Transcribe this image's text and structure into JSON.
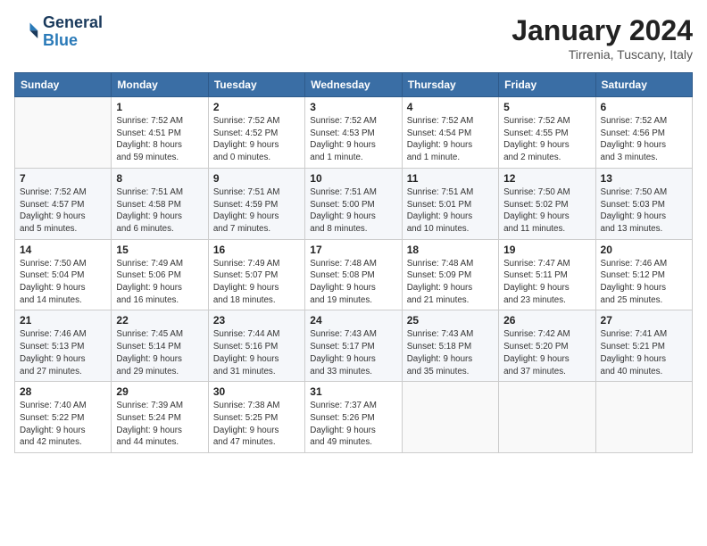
{
  "header": {
    "logo_line1": "General",
    "logo_line2": "Blue",
    "month": "January 2024",
    "location": "Tirrenia, Tuscany, Italy"
  },
  "days_of_week": [
    "Sunday",
    "Monday",
    "Tuesday",
    "Wednesday",
    "Thursday",
    "Friday",
    "Saturday"
  ],
  "weeks": [
    [
      {
        "day": "",
        "info": ""
      },
      {
        "day": "1",
        "info": "Sunrise: 7:52 AM\nSunset: 4:51 PM\nDaylight: 8 hours\nand 59 minutes."
      },
      {
        "day": "2",
        "info": "Sunrise: 7:52 AM\nSunset: 4:52 PM\nDaylight: 9 hours\nand 0 minutes."
      },
      {
        "day": "3",
        "info": "Sunrise: 7:52 AM\nSunset: 4:53 PM\nDaylight: 9 hours\nand 1 minute."
      },
      {
        "day": "4",
        "info": "Sunrise: 7:52 AM\nSunset: 4:54 PM\nDaylight: 9 hours\nand 1 minute."
      },
      {
        "day": "5",
        "info": "Sunrise: 7:52 AM\nSunset: 4:55 PM\nDaylight: 9 hours\nand 2 minutes."
      },
      {
        "day": "6",
        "info": "Sunrise: 7:52 AM\nSunset: 4:56 PM\nDaylight: 9 hours\nand 3 minutes."
      }
    ],
    [
      {
        "day": "7",
        "info": "Sunrise: 7:52 AM\nSunset: 4:57 PM\nDaylight: 9 hours\nand 5 minutes."
      },
      {
        "day": "8",
        "info": "Sunrise: 7:51 AM\nSunset: 4:58 PM\nDaylight: 9 hours\nand 6 minutes."
      },
      {
        "day": "9",
        "info": "Sunrise: 7:51 AM\nSunset: 4:59 PM\nDaylight: 9 hours\nand 7 minutes."
      },
      {
        "day": "10",
        "info": "Sunrise: 7:51 AM\nSunset: 5:00 PM\nDaylight: 9 hours\nand 8 minutes."
      },
      {
        "day": "11",
        "info": "Sunrise: 7:51 AM\nSunset: 5:01 PM\nDaylight: 9 hours\nand 10 minutes."
      },
      {
        "day": "12",
        "info": "Sunrise: 7:50 AM\nSunset: 5:02 PM\nDaylight: 9 hours\nand 11 minutes."
      },
      {
        "day": "13",
        "info": "Sunrise: 7:50 AM\nSunset: 5:03 PM\nDaylight: 9 hours\nand 13 minutes."
      }
    ],
    [
      {
        "day": "14",
        "info": "Sunrise: 7:50 AM\nSunset: 5:04 PM\nDaylight: 9 hours\nand 14 minutes."
      },
      {
        "day": "15",
        "info": "Sunrise: 7:49 AM\nSunset: 5:06 PM\nDaylight: 9 hours\nand 16 minutes."
      },
      {
        "day": "16",
        "info": "Sunrise: 7:49 AM\nSunset: 5:07 PM\nDaylight: 9 hours\nand 18 minutes."
      },
      {
        "day": "17",
        "info": "Sunrise: 7:48 AM\nSunset: 5:08 PM\nDaylight: 9 hours\nand 19 minutes."
      },
      {
        "day": "18",
        "info": "Sunrise: 7:48 AM\nSunset: 5:09 PM\nDaylight: 9 hours\nand 21 minutes."
      },
      {
        "day": "19",
        "info": "Sunrise: 7:47 AM\nSunset: 5:11 PM\nDaylight: 9 hours\nand 23 minutes."
      },
      {
        "day": "20",
        "info": "Sunrise: 7:46 AM\nSunset: 5:12 PM\nDaylight: 9 hours\nand 25 minutes."
      }
    ],
    [
      {
        "day": "21",
        "info": "Sunrise: 7:46 AM\nSunset: 5:13 PM\nDaylight: 9 hours\nand 27 minutes."
      },
      {
        "day": "22",
        "info": "Sunrise: 7:45 AM\nSunset: 5:14 PM\nDaylight: 9 hours\nand 29 minutes."
      },
      {
        "day": "23",
        "info": "Sunrise: 7:44 AM\nSunset: 5:16 PM\nDaylight: 9 hours\nand 31 minutes."
      },
      {
        "day": "24",
        "info": "Sunrise: 7:43 AM\nSunset: 5:17 PM\nDaylight: 9 hours\nand 33 minutes."
      },
      {
        "day": "25",
        "info": "Sunrise: 7:43 AM\nSunset: 5:18 PM\nDaylight: 9 hours\nand 35 minutes."
      },
      {
        "day": "26",
        "info": "Sunrise: 7:42 AM\nSunset: 5:20 PM\nDaylight: 9 hours\nand 37 minutes."
      },
      {
        "day": "27",
        "info": "Sunrise: 7:41 AM\nSunset: 5:21 PM\nDaylight: 9 hours\nand 40 minutes."
      }
    ],
    [
      {
        "day": "28",
        "info": "Sunrise: 7:40 AM\nSunset: 5:22 PM\nDaylight: 9 hours\nand 42 minutes."
      },
      {
        "day": "29",
        "info": "Sunrise: 7:39 AM\nSunset: 5:24 PM\nDaylight: 9 hours\nand 44 minutes."
      },
      {
        "day": "30",
        "info": "Sunrise: 7:38 AM\nSunset: 5:25 PM\nDaylight: 9 hours\nand 47 minutes."
      },
      {
        "day": "31",
        "info": "Sunrise: 7:37 AM\nSunset: 5:26 PM\nDaylight: 9 hours\nand 49 minutes."
      },
      {
        "day": "",
        "info": ""
      },
      {
        "day": "",
        "info": ""
      },
      {
        "day": "",
        "info": ""
      }
    ]
  ]
}
